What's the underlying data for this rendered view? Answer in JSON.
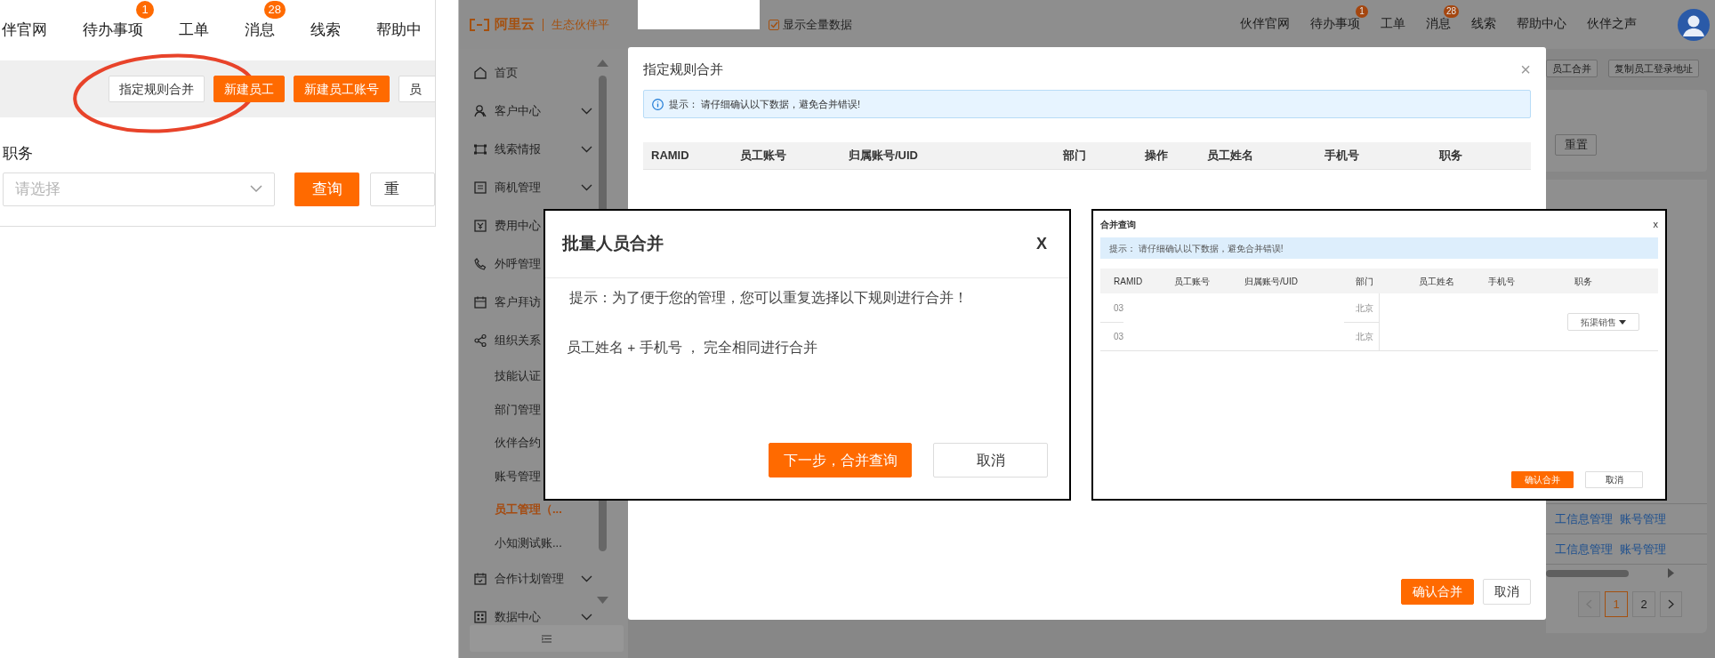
{
  "zoomed_view": {
    "nav": [
      {
        "label": "伴官网"
      },
      {
        "label": "待办事项",
        "badge": "1"
      },
      {
        "label": "工单"
      },
      {
        "label": "消息",
        "badge": "28"
      },
      {
        "label": "线索"
      },
      {
        "label": "帮助中"
      }
    ],
    "toolbar_buttons": [
      {
        "label": "指定规则合并",
        "kind": "plain"
      },
      {
        "label": "新建员工",
        "kind": "primary"
      },
      {
        "label": "新建员工账号",
        "kind": "primary"
      },
      {
        "label": "员",
        "kind": "plain"
      }
    ],
    "filter": {
      "label": "职务",
      "placeholder": "请选择"
    },
    "filter_buttons": [
      {
        "label": "查询",
        "kind": "primary"
      },
      {
        "label": "重",
        "kind": "plain"
      }
    ]
  },
  "app": {
    "brand": {
      "logo": "阿里云",
      "product": "生态伙伴平"
    },
    "show_all": {
      "label": "显示全量数据",
      "checked": true
    },
    "nav": [
      {
        "label": "伙伴官网"
      },
      {
        "label": "待办事项",
        "badge": "1"
      },
      {
        "label": "工单"
      },
      {
        "label": "消息",
        "badge": "28"
      },
      {
        "label": "线索"
      },
      {
        "label": "帮助中心"
      },
      {
        "label": "伙伴之声"
      }
    ],
    "sidebar": {
      "items": [
        {
          "label": "首页",
          "selected": false
        },
        {
          "label": "客户中心",
          "selected": false,
          "expanded": false
        },
        {
          "label": "线索情报",
          "selected": false,
          "expanded": false
        },
        {
          "label": "商机管理",
          "selected": false,
          "expanded": false
        },
        {
          "label": "费用中心",
          "selected": false
        },
        {
          "label": "外呼管理",
          "selected": false
        },
        {
          "label": "客户拜访",
          "selected": false
        },
        {
          "label": "组织关系",
          "selected": false,
          "children": [
            {
              "label": "技能认证",
              "selected": false
            },
            {
              "label": "部门管理",
              "selected": false
            },
            {
              "label": "伙伴合约",
              "selected": false
            },
            {
              "label": "账号管理",
              "selected": false
            },
            {
              "label": "员工管理（...",
              "selected": true
            },
            {
              "label": "小知测试账...",
              "selected": false
            }
          ]
        },
        {
          "label": "合作计划管理",
          "selected": false,
          "expanded": false
        },
        {
          "label": "数据中心",
          "selected": false,
          "expanded": false
        }
      ]
    },
    "page": {
      "toolbar_buttons": [
        "员工合并",
        "复制员工登录地址"
      ],
      "reset_button": "重置",
      "rows": [
        {
          "links": [
            "工信息管理",
            "账号管理"
          ]
        },
        {
          "links": [
            "工信息管理",
            "账号管理"
          ]
        }
      ],
      "pagination": [
        {
          "label": "1",
          "selected": true
        },
        {
          "label": "2",
          "selected": false
        }
      ]
    }
  },
  "rule_merge_modal": {
    "title": "指定规则合并",
    "close": "×",
    "alert": "提示：  请仔细确认以下数据，避免合并错误!",
    "columns": [
      "RAMID",
      "员工账号",
      "归属账号/UID",
      "部门",
      "操作",
      "员工姓名",
      "手机号",
      "职务"
    ],
    "buttons": [
      {
        "label": "确认合并",
        "kind": "primary"
      },
      {
        "label": "取消",
        "kind": "plain"
      }
    ]
  },
  "batch_merge_dialog": {
    "title": "批量人员合并",
    "close": "X",
    "hint": "提示：为了便于您的管理，您可以重复选择以下规则进行合并！",
    "rule": "员工姓名 + 手机号 ， 完全相同进行合并",
    "buttons": [
      {
        "label": "下一步，合并查询",
        "kind": "primary"
      },
      {
        "label": "取消",
        "kind": "plain"
      }
    ]
  },
  "merge_query_dialog": {
    "title": "合并查询",
    "close": "x",
    "alert": "提示：  请仔细确认以下数据，避免合并错误!",
    "columns": [
      "RAMID",
      "员工账号",
      "归属账号/UID",
      "部门",
      "员工姓名",
      "手机号",
      "职务"
    ],
    "rows": [
      {
        "ramid": "03",
        "department": "北京"
      },
      {
        "ramid": "03",
        "department": "北京"
      }
    ],
    "role_select": "拓渠销售",
    "buttons": [
      {
        "label": "确认合并",
        "kind": "primary"
      },
      {
        "label": "取消",
        "kind": "plain"
      }
    ]
  }
}
